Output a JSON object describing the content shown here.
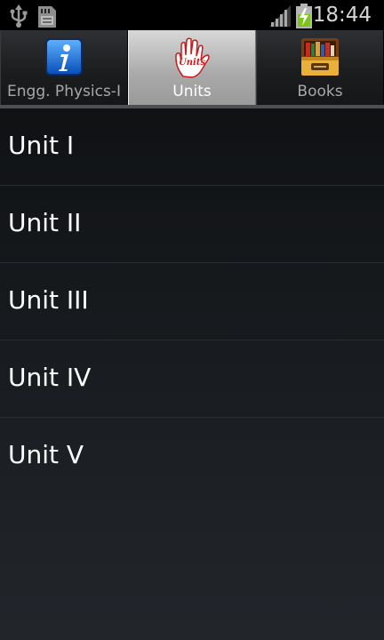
{
  "status_bar": {
    "time": "18:44",
    "icons": [
      "usb-icon",
      "sd-card-icon",
      "signal-icon",
      "battery-charging-icon"
    ]
  },
  "tabs": [
    {
      "label": "Engg. Physics-I",
      "icon": "info-icon",
      "selected": false
    },
    {
      "label": "Units",
      "icon": "hand-units-icon",
      "selected": true
    },
    {
      "label": "Books",
      "icon": "bookshelf-icon",
      "selected": false
    }
  ],
  "tab_icon_text": "Units",
  "units": [
    {
      "label": "Unit I"
    },
    {
      "label": "Unit II"
    },
    {
      "label": "Unit III"
    },
    {
      "label": "Unit IV"
    },
    {
      "label": "Unit V"
    }
  ],
  "colors": {
    "status_bar_bg": "#000000",
    "selected_tab": "#b0b0b0",
    "battery_green": "#7ec31c",
    "text": "#ffffff"
  }
}
